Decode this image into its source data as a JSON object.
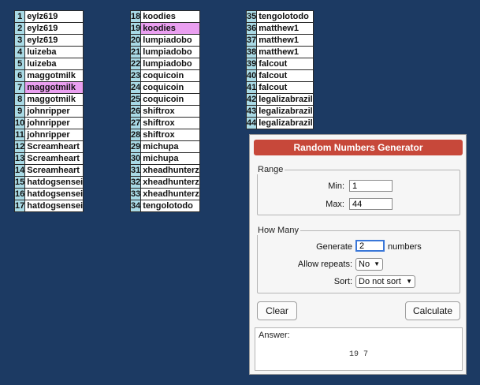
{
  "lists": {
    "columns": [
      [
        {
          "num": "1",
          "name": "eylz619"
        },
        {
          "num": "2",
          "name": "eylz619"
        },
        {
          "num": "3",
          "name": "eylz619"
        },
        {
          "num": "4",
          "name": "luizeba"
        },
        {
          "num": "5",
          "name": "luizeba"
        },
        {
          "num": "6",
          "name": "maggotmilk"
        },
        {
          "num": "7",
          "name": "maggotmilk",
          "highlighted": true
        },
        {
          "num": "8",
          "name": "maggotmilk"
        },
        {
          "num": "9",
          "name": "johnripper"
        },
        {
          "num": "10",
          "name": "johnripper"
        },
        {
          "num": "11",
          "name": "johnripper"
        },
        {
          "num": "12",
          "name": "Screamheart"
        },
        {
          "num": "13",
          "name": "Screamheart"
        },
        {
          "num": "14",
          "name": "Screamheart"
        },
        {
          "num": "15",
          "name": "hatdogsensei"
        },
        {
          "num": "16",
          "name": "hatdogsensei"
        },
        {
          "num": "17",
          "name": "hatdogsensei"
        }
      ],
      [
        {
          "num": "18",
          "name": "koodies"
        },
        {
          "num": "19",
          "name": "koodies",
          "highlighted": true
        },
        {
          "num": "20",
          "name": "lumpiadobo"
        },
        {
          "num": "21",
          "name": "lumpiadobo"
        },
        {
          "num": "22",
          "name": "lumpiadobo"
        },
        {
          "num": "23",
          "name": "coquicoin"
        },
        {
          "num": "24",
          "name": "coquicoin"
        },
        {
          "num": "25",
          "name": "coquicoin"
        },
        {
          "num": "26",
          "name": "shiftrox"
        },
        {
          "num": "27",
          "name": "shiftrox"
        },
        {
          "num": "28",
          "name": "shiftrox"
        },
        {
          "num": "29",
          "name": "michupa"
        },
        {
          "num": "30",
          "name": "michupa"
        },
        {
          "num": "31",
          "name": "xheadhunterz"
        },
        {
          "num": "32",
          "name": "xheadhunterz"
        },
        {
          "num": "33",
          "name": "xheadhunterz"
        },
        {
          "num": "34",
          "name": "tengolotodo"
        }
      ],
      [
        {
          "num": "35",
          "name": "tengolotodo"
        },
        {
          "num": "36",
          "name": "matthew1"
        },
        {
          "num": "37",
          "name": "matthew1"
        },
        {
          "num": "38",
          "name": "matthew1"
        },
        {
          "num": "39",
          "name": "falcout"
        },
        {
          "num": "40",
          "name": "falcout"
        },
        {
          "num": "41",
          "name": "falcout"
        },
        {
          "num": "42",
          "name": "legalizabrazil"
        },
        {
          "num": "43",
          "name": "legalizabrazil"
        },
        {
          "num": "44",
          "name": "legalizabrazil"
        }
      ]
    ],
    "highlight_color": "#ea9ff0",
    "number_cell_color": "#a9dae5"
  },
  "generator": {
    "title": "Random Numbers Generator",
    "title_color": "#c7483a",
    "range": {
      "legend": "Range",
      "min_label": "Min:",
      "min_value": "1",
      "max_label": "Max:",
      "max_value": "44"
    },
    "how_many": {
      "legend": "How Many",
      "generate_label": "Generate",
      "generate_value": "2",
      "numbers_suffix": "numbers",
      "repeats_label": "Allow repeats:",
      "repeats_value": "No",
      "sort_label": "Sort:",
      "sort_value": "Do not sort"
    },
    "clear_label": "Clear",
    "calculate_label": "Calculate",
    "answer_label": "Answer:",
    "answer_value": "19 7"
  }
}
